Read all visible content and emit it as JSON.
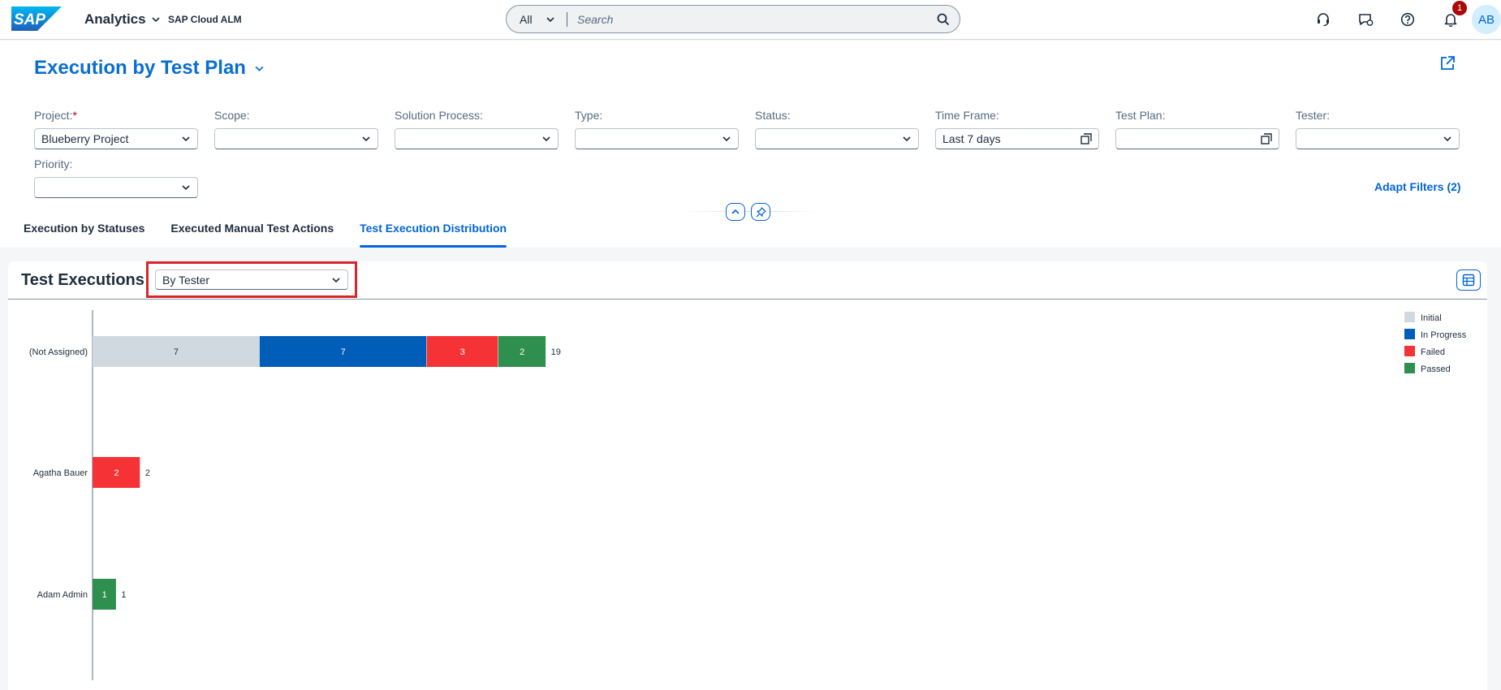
{
  "shell": {
    "logo_text": "SAP",
    "app_title": "Analytics",
    "app_subtitle": "SAP Cloud ALM",
    "search_scope": "All",
    "search_placeholder": "Search",
    "notification_count": "1",
    "avatar_initials": "AB",
    "icons": [
      "headset-icon",
      "feedback-icon",
      "help-icon",
      "bell-icon"
    ]
  },
  "page": {
    "title": "Execution by Test Plan",
    "filters": [
      {
        "label": "Project:",
        "required": "*",
        "value": "Blueberry Project",
        "control": "dropdown"
      },
      {
        "label": "Scope:",
        "value": "",
        "control": "dropdown"
      },
      {
        "label": "Solution Process:",
        "value": "",
        "control": "dropdown"
      },
      {
        "label": "Type:",
        "value": "",
        "control": "dropdown"
      },
      {
        "label": "Status:",
        "value": "",
        "control": "dropdown"
      },
      {
        "label": "Time Frame:",
        "value": "Last 7 days",
        "control": "value-help"
      },
      {
        "label": "Test Plan:",
        "value": "",
        "control": "value-help"
      },
      {
        "label": "Tester:",
        "value": "",
        "control": "dropdown"
      },
      {
        "label": "Priority:",
        "value": "",
        "control": "dropdown"
      }
    ],
    "adapt_filters": "Adapt Filters (2)",
    "tabs": [
      {
        "label": "Execution by Statuses",
        "active": false
      },
      {
        "label": "Executed Manual Test Actions",
        "active": false
      },
      {
        "label": "Test Execution Distribution",
        "active": true
      }
    ]
  },
  "card": {
    "title": "Test Executions",
    "view_select": "By Tester"
  },
  "colors": {
    "brand": "#0a6ed1",
    "Initial": "#d1d9e0",
    "In Progress": "#005eb8",
    "Failed": "#f53337",
    "Passed": "#2f8f4e"
  },
  "chart_data": {
    "type": "bar",
    "orientation": "horizontal",
    "stacked": true,
    "categories": [
      "(Not Assigned)",
      "Agatha Bauer",
      "Adam Admin"
    ],
    "series": [
      {
        "name": "Initial",
        "values": [
          7,
          0,
          0
        ]
      },
      {
        "name": "In Progress",
        "values": [
          7,
          0,
          0
        ]
      },
      {
        "name": "Failed",
        "values": [
          3,
          2,
          0
        ]
      },
      {
        "name": "Passed",
        "values": [
          2,
          0,
          1
        ]
      }
    ],
    "totals": [
      19,
      2,
      1
    ],
    "legend_position": "top-right",
    "grid": false
  }
}
